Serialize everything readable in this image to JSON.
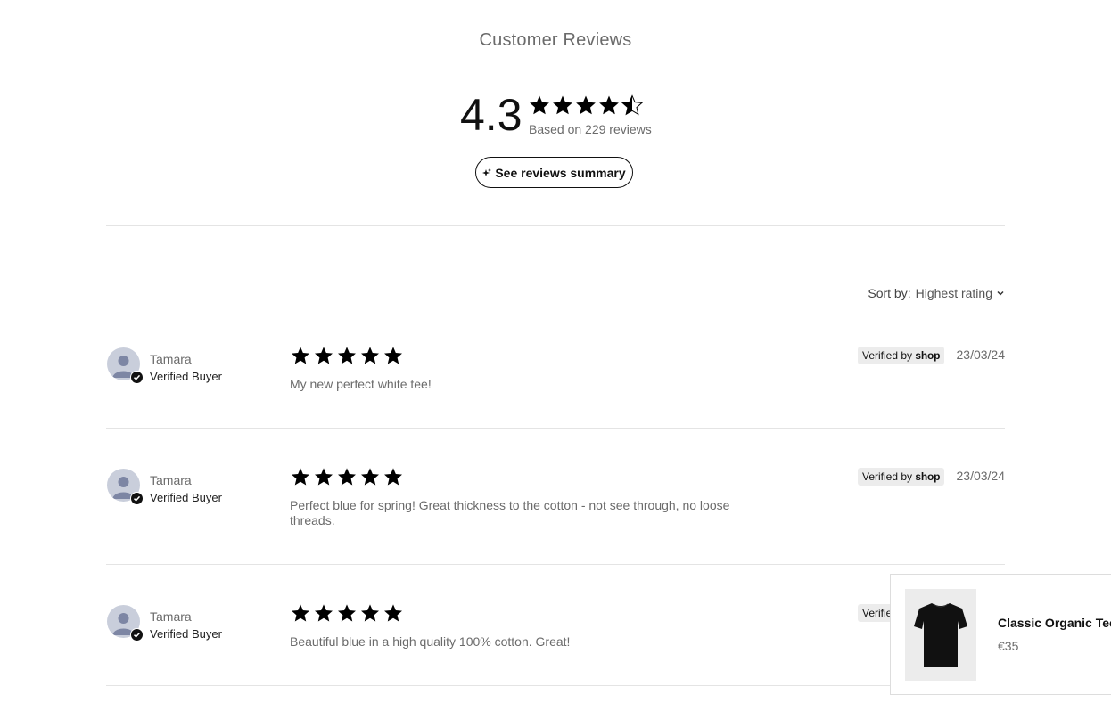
{
  "header": {
    "title": "Customer Reviews",
    "average": "4.3",
    "average_stars": 4.5,
    "based_on": "Based on 229 reviews",
    "summary_button": "See reviews summary"
  },
  "sort": {
    "label": "Sort by:",
    "value": "Highest rating"
  },
  "verified_badge": {
    "prefix": "Verified by",
    "brand": "shop"
  },
  "reviews": [
    {
      "name": "Tamara",
      "status": "Verified Buyer",
      "rating": 5,
      "date": "23/03/24",
      "text": "My new perfect white tee!"
    },
    {
      "name": "Tamara",
      "status": "Verified Buyer",
      "rating": 5,
      "date": "23/03/24",
      "text": "Perfect blue for spring! Great thickness to the cotton - not see through, no loose threads."
    },
    {
      "name": "Tamara",
      "status": "Verified Buyer",
      "rating": 5,
      "date": "",
      "text": "Beautiful blue in a high quality 100% cotton. Great!"
    }
  ],
  "product_popup": {
    "name": "Classic Organic Tee",
    "price": "€35"
  },
  "colors": {
    "star": "#000000",
    "muted_text": "#6b6b6b",
    "badge_bg": "#ececec",
    "avatar_bg": "#c9cedb"
  },
  "icons": {
    "star": "star-icon",
    "sparkle": "sparkle-icon",
    "chevron": "chevron-down-icon",
    "avatar": "user-avatar-icon",
    "check": "checkmark-icon"
  }
}
